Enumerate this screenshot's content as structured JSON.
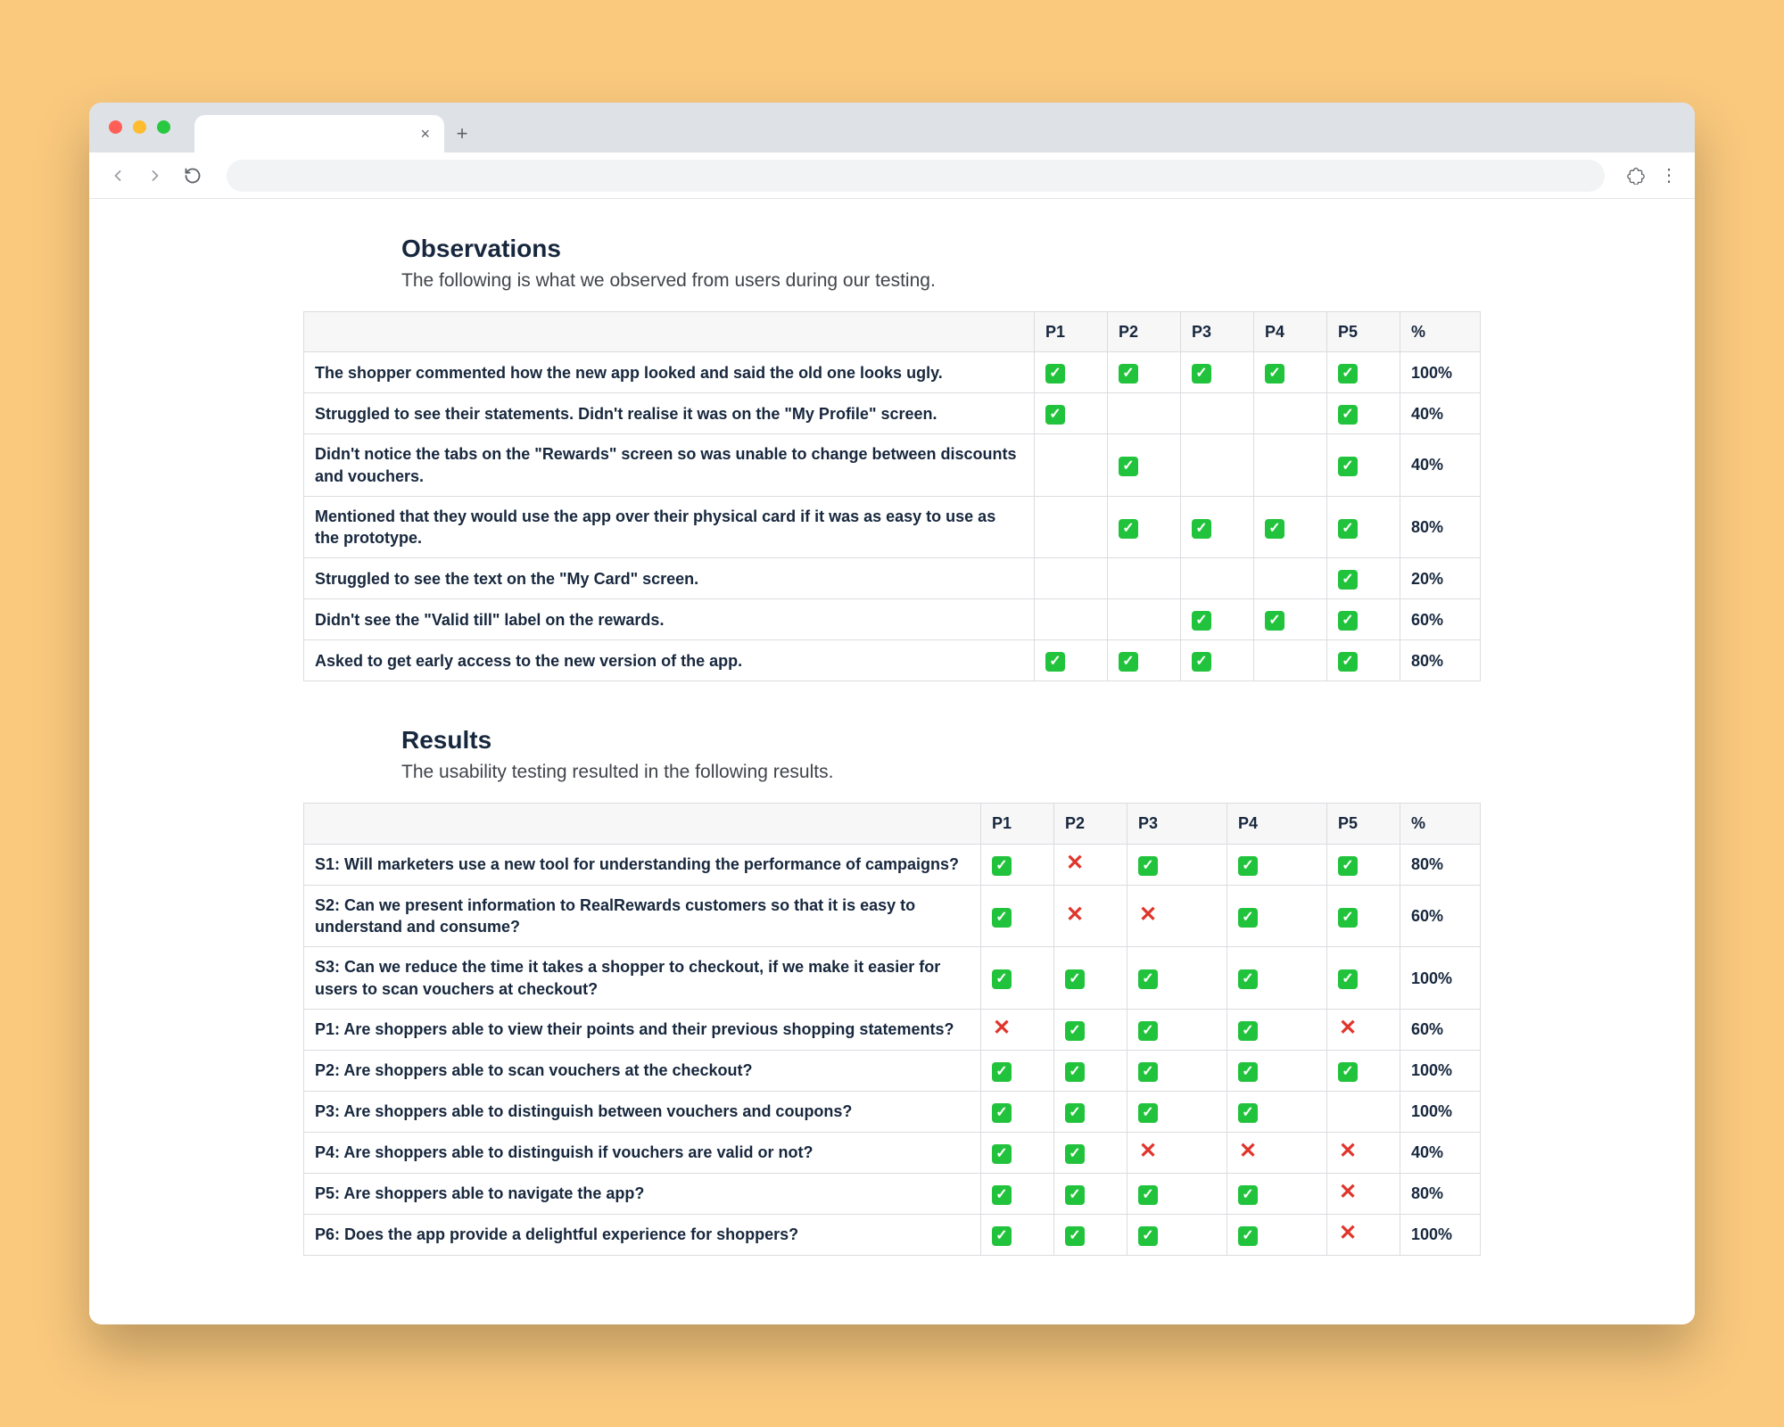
{
  "sections": {
    "observations": {
      "title": "Observations",
      "subtitle": "The following is what we observed from users during our testing."
    },
    "results": {
      "title": "Results",
      "subtitle": "The usability testing resulted in the following results."
    }
  },
  "columns": [
    "P1",
    "P2",
    "P3",
    "P4",
    "P5",
    "%"
  ],
  "observations_rows": [
    {
      "label": "The shopper commented how the new app looked and said the old one looks ugly.",
      "marks": [
        "y",
        "y",
        "y",
        "y",
        "y"
      ],
      "pct": "100%"
    },
    {
      "label": "Struggled to see their statements. Didn't realise it was on the \"My Profile\" screen.",
      "marks": [
        "y",
        "",
        "",
        "",
        "y"
      ],
      "pct": "40%"
    },
    {
      "label": "Didn't notice the tabs on the \"Rewards\" screen so was unable to change between discounts and vouchers.",
      "marks": [
        "",
        "y",
        "",
        "",
        "y"
      ],
      "pct": "40%"
    },
    {
      "label": "Mentioned that they would use the app over their physical card if it was as easy to use as the prototype.",
      "marks": [
        "",
        "y",
        "y",
        "y",
        "y"
      ],
      "pct": "80%"
    },
    {
      "label": "Struggled to see the text on the \"My Card\" screen.",
      "marks": [
        "",
        "",
        "",
        "",
        "y"
      ],
      "pct": "20%"
    },
    {
      "label": "Didn't see the \"Valid till\" label on the rewards.",
      "marks": [
        "",
        "",
        "y",
        "y",
        "y"
      ],
      "pct": "60%"
    },
    {
      "label": "Asked to get early access to the new version of the app.",
      "marks": [
        "y",
        "y",
        "y",
        "",
        "y"
      ],
      "pct": "80%"
    }
  ],
  "results_rows": [
    {
      "label": "S1: Will marketers use a new tool for understanding the performance of campaigns?",
      "marks": [
        "y",
        "n",
        "y",
        "y",
        "y"
      ],
      "pct": "80%"
    },
    {
      "label": "S2: Can we present information to RealRewards customers so that it is easy to understand and consume?",
      "marks": [
        "y",
        "n",
        "n",
        "y",
        "y"
      ],
      "pct": "60%"
    },
    {
      "label": "S3: Can we reduce the time it takes a shopper to checkout, if we make it easier for users to scan vouchers at checkout?",
      "marks": [
        "y",
        "y",
        "y",
        "y",
        "y"
      ],
      "pct": "100%"
    },
    {
      "label": "P1: Are shoppers able to view their points and their previous shopping statements?",
      "marks": [
        "n",
        "y",
        "y",
        "y",
        "n"
      ],
      "pct": "60%"
    },
    {
      "label": "P2: Are shoppers able to scan vouchers at the checkout?",
      "marks": [
        "y",
        "y",
        "y",
        "y",
        "y"
      ],
      "pct": "100%"
    },
    {
      "label": "P3: Are shoppers able to distinguish between vouchers and coupons?",
      "marks": [
        "y",
        "y",
        "y",
        "y",
        ""
      ],
      "pct": "100%"
    },
    {
      "label": "P4: Are shoppers able to distinguish if vouchers are valid or not?",
      "marks": [
        "y",
        "y",
        "n",
        "n",
        "n"
      ],
      "pct": "40%"
    },
    {
      "label": "P5: Are shoppers able to navigate the app?",
      "marks": [
        "y",
        "y",
        "y",
        "y",
        "n"
      ],
      "pct": "80%"
    },
    {
      "label": "P6: Does the app provide a delightful experience for shoppers?",
      "marks": [
        "y",
        "y",
        "y",
        "y",
        "n"
      ],
      "pct": "100%"
    }
  ]
}
